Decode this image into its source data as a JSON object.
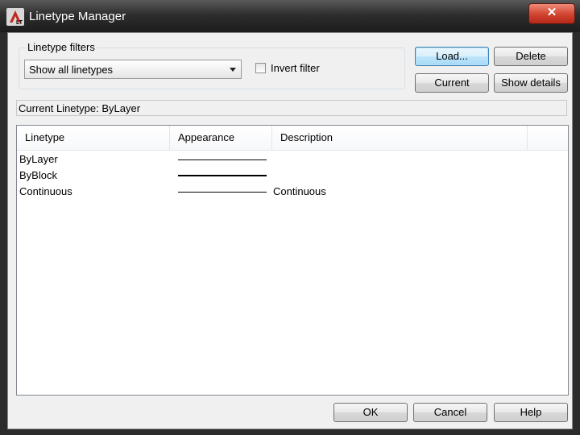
{
  "window": {
    "title": "Linetype Manager",
    "close_glyph": "✕"
  },
  "filters": {
    "group_label": "Linetype filters",
    "selected": "Show all linetypes",
    "invert_label": "Invert filter",
    "invert_checked": false
  },
  "buttons": {
    "load": "Load...",
    "delete": "Delete",
    "current": "Current",
    "show_details": "Show details"
  },
  "current_linetype": "Current Linetype:  ByLayer",
  "table": {
    "columns": [
      "Linetype",
      "Appearance",
      "Description"
    ],
    "rows": [
      {
        "name": "ByLayer",
        "appearance": "thin",
        "description": ""
      },
      {
        "name": "ByBlock",
        "appearance": "bold",
        "description": ""
      },
      {
        "name": "Continuous",
        "appearance": "thin",
        "description": "Continuous"
      }
    ]
  },
  "footer": {
    "ok": "OK",
    "cancel": "Cancel",
    "help": "Help"
  }
}
